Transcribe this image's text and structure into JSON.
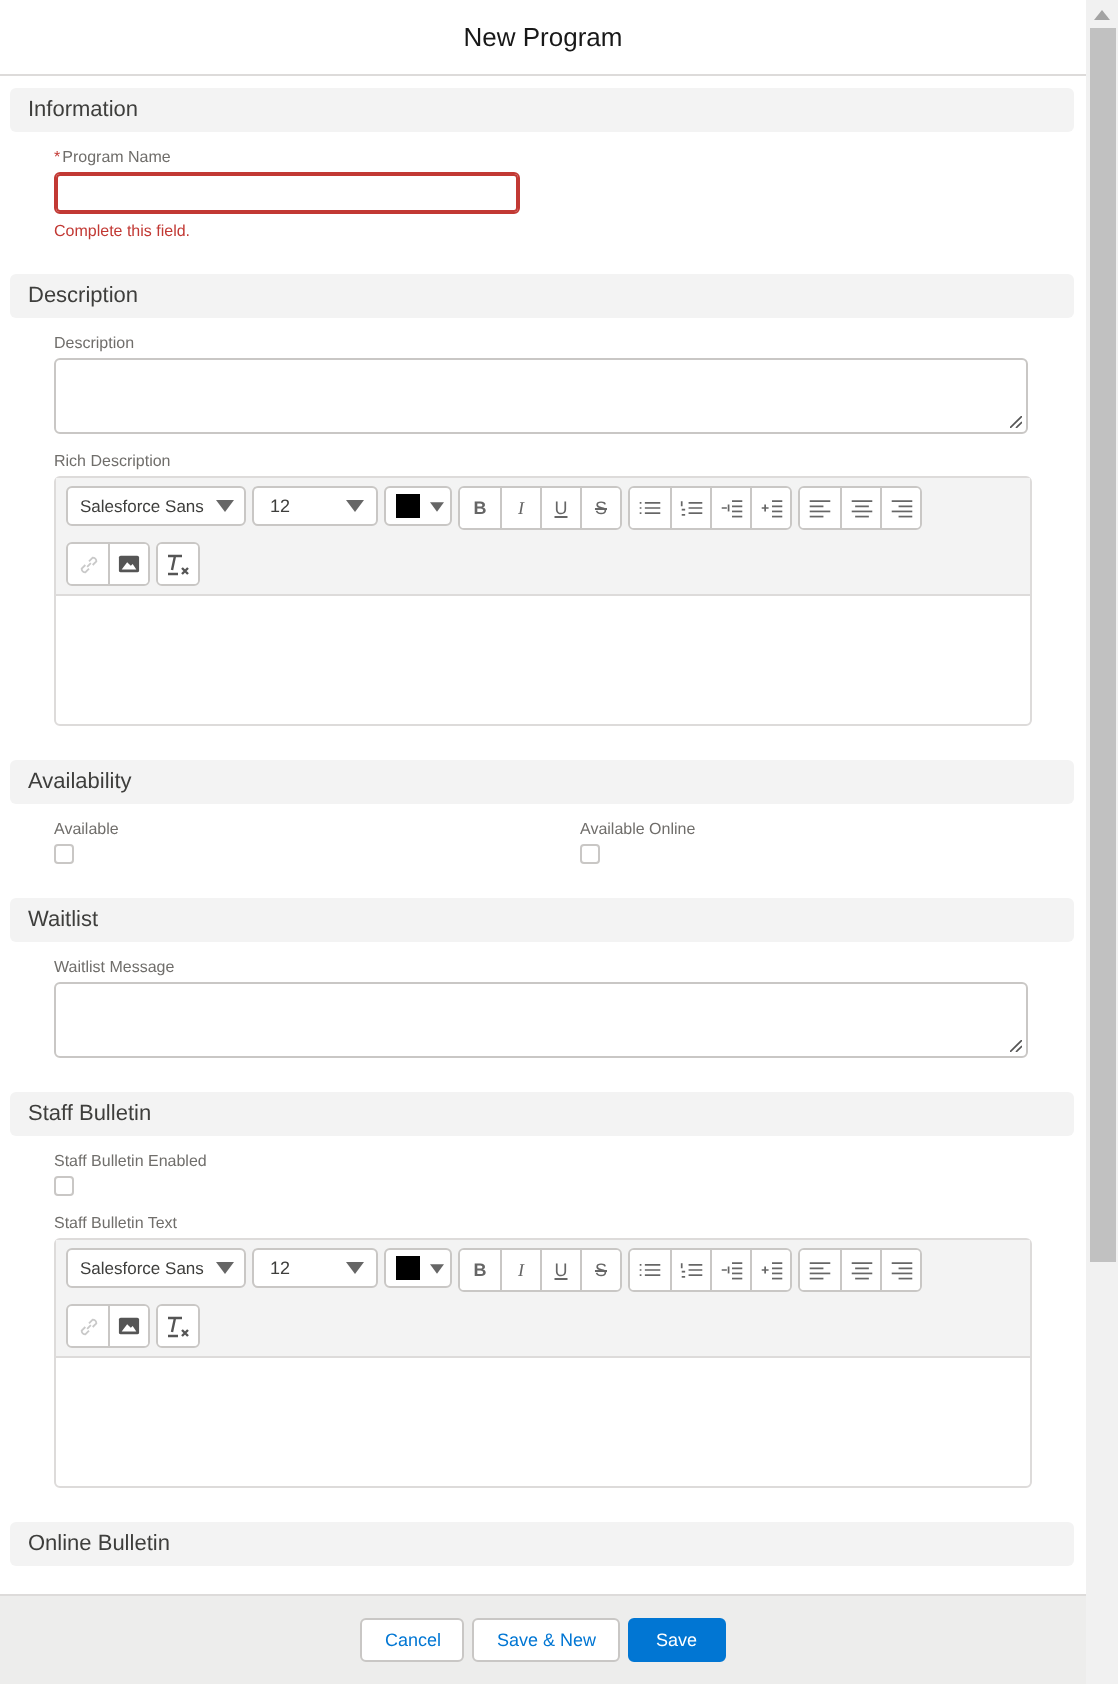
{
  "title": "New Program",
  "sections": [
    {
      "title": "Information",
      "fields": [
        {
          "kind": "text",
          "label": "Program Name",
          "required_mark": "*",
          "error": "Complete this field."
        }
      ]
    },
    {
      "title": "Description",
      "fields": [
        {
          "kind": "textarea",
          "label": "Description"
        },
        {
          "kind": "rich",
          "label": "Rich Description",
          "font": "Salesforce Sans",
          "size": "12",
          "tools": [
            [
              {
                "kind": "bold",
                "label": "B"
              },
              {
                "kind": "italic",
                "label": "I"
              },
              {
                "kind": "underline",
                "label": "U"
              },
              {
                "kind": "strike",
                "label": "S"
              }
            ],
            [
              {
                "kind": "bullets"
              },
              {
                "kind": "numbers"
              },
              {
                "kind": "outdent"
              },
              {
                "kind": "indent"
              }
            ],
            [
              {
                "kind": "align-left"
              },
              {
                "kind": "align-center"
              },
              {
                "kind": "align-right"
              }
            ],
            [
              {
                "kind": "link",
                "disabled": true
              },
              {
                "kind": "image",
                "disabled": false
              }
            ],
            [
              {
                "kind": "clear-format"
              }
            ]
          ]
        }
      ]
    },
    {
      "title": "Availability",
      "fields": [
        {
          "kind": "checkbox",
          "label": "Available",
          "checked": false
        },
        {
          "kind": "checkbox",
          "label": "Available Online",
          "checked": false
        }
      ]
    },
    {
      "title": "Waitlist",
      "fields": [
        {
          "kind": "textarea",
          "label": "Waitlist Message"
        }
      ]
    },
    {
      "title": "Staff Bulletin",
      "fields": [
        {
          "kind": "checkbox",
          "label": "Staff Bulletin Enabled",
          "checked": false
        },
        {
          "kind": "rich",
          "label": "Staff Bulletin Text",
          "font": "Salesforce Sans",
          "size": "12",
          "tools": [
            [
              {
                "kind": "bold",
                "label": "B"
              },
              {
                "kind": "italic",
                "label": "I"
              },
              {
                "kind": "underline",
                "label": "U"
              },
              {
                "kind": "strike",
                "label": "S"
              }
            ],
            [
              {
                "kind": "bullets"
              },
              {
                "kind": "numbers"
              },
              {
                "kind": "outdent"
              },
              {
                "kind": "indent"
              }
            ],
            [
              {
                "kind": "align-left"
              },
              {
                "kind": "align-center"
              },
              {
                "kind": "align-right"
              }
            ],
            [
              {
                "kind": "link",
                "disabled": true
              },
              {
                "kind": "image",
                "disabled": false
              }
            ],
            [
              {
                "kind": "clear-format"
              }
            ]
          ]
        }
      ]
    },
    {
      "title": "Online Bulletin"
    }
  ],
  "buttons": [
    {
      "kind": "neutral",
      "label": "Cancel"
    },
    {
      "kind": "neutral",
      "label": "Save & New"
    },
    {
      "kind": "primary",
      "label": "Save"
    }
  ]
}
